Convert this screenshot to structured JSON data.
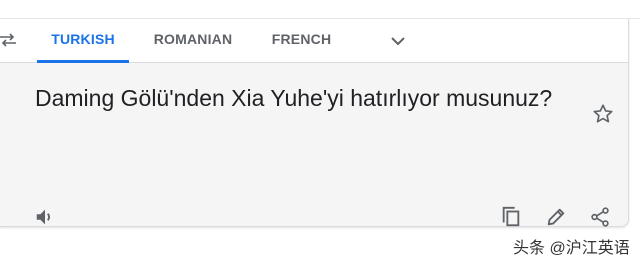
{
  "tabs": [
    {
      "label": "TURKISH",
      "active": true
    },
    {
      "label": "ROMANIAN",
      "active": false
    },
    {
      "label": "FRENCH",
      "active": false
    }
  ],
  "translation": {
    "text": "Daming Gölü'nden Xia Yuhe'yi hatırlıyor musunuz?"
  },
  "icons": {
    "swap": "swap-languages-icon",
    "more": "chevron-down-icon",
    "star": "star-icon",
    "speaker": "speaker-icon",
    "copy": "copy-icon",
    "edit": "edit-icon",
    "share": "share-icon"
  },
  "colors": {
    "accent": "#1a73e8",
    "tab_inactive": "#5f6368",
    "card_bg": "#f5f5f5",
    "icon": "#5f6368"
  },
  "watermark": "头条 @沪江英语"
}
